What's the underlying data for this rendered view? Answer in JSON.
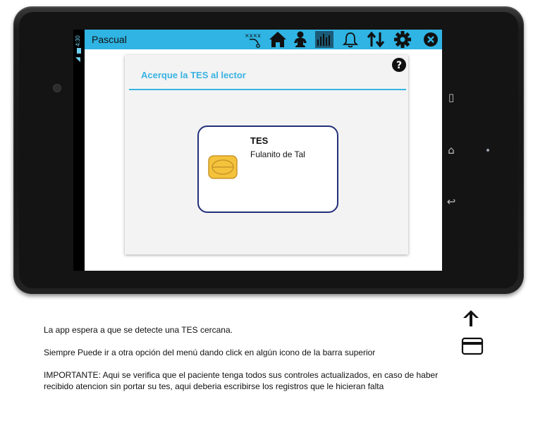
{
  "device": {
    "status_time": "4:30"
  },
  "appbar": {
    "title": "Pascual",
    "icons": [
      "tactics-icon",
      "home-icon",
      "baby-icon",
      "bar-chart-icon",
      "bell-icon",
      "sync-arrows-icon",
      "gear-icon",
      "close-icon"
    ],
    "accent_color": "#2fb4e3"
  },
  "dialog": {
    "title": "Acerque la TES al lector",
    "help_icon": "help-icon",
    "accent_color": "#39b3e2"
  },
  "card": {
    "title": "TES",
    "name": "Fulanito de Tal",
    "border_color": "#23307a",
    "chip_color": "#f5c33b"
  },
  "side_icons": [
    "up-arrow-icon",
    "credit-card-icon"
  ],
  "description": {
    "line1": "La app espera a que se detecte una TES cercana.",
    "line2": "Siempre Puede ir a otra opción del menú dando click en algún icono de la barra superior",
    "important_label": "IMPORTANTE",
    "important_text": ": Aqui se verifica que el paciente tenga todos sus controles actualizados, en caso de haber recibido atencion sin portar su tes, aqui deberia escribirse los registros que le hicieran falta"
  }
}
